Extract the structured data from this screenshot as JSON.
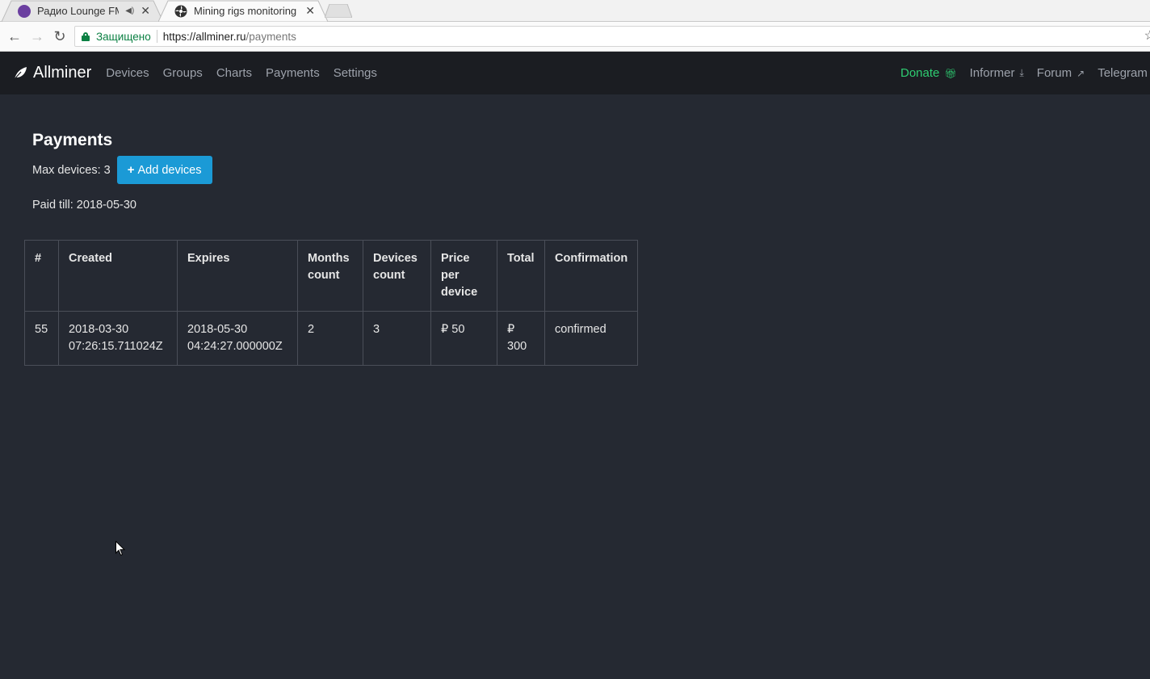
{
  "browser": {
    "tabs": [
      {
        "title": "Радио Lounge FM Ch",
        "active": false,
        "audio": true
      },
      {
        "title": "Mining rigs monitoring -",
        "active": true,
        "audio": false
      }
    ],
    "secure_label": "Защищено",
    "url_host": "https://allminer.ru",
    "url_path": "/payments"
  },
  "navbar": {
    "brand": "Allminer",
    "links": [
      "Devices",
      "Groups",
      "Charts",
      "Payments",
      "Settings"
    ],
    "right": {
      "donate": "Donate",
      "informer": "Informer",
      "forum": "Forum",
      "telegram": "Telegram"
    },
    "colors": {
      "donate": "#2ecc71",
      "accent": "#1b9ad6"
    }
  },
  "page": {
    "title": "Payments",
    "max_devices": "Max devices: 3",
    "add_devices": "Add devices",
    "paid_till": "Paid till: 2018-05-30"
  },
  "table": {
    "headers": [
      "#",
      "Created",
      "Expires",
      "Months count",
      "Devices count",
      "Price per device",
      "Total",
      "Confirmation"
    ],
    "rows": [
      {
        "id": "55",
        "created": "2018-03-30 07:26:15.711024Z",
        "expires": "2018-05-30 04:24:27.000000Z",
        "months": "2",
        "devices": "3",
        "price": "₽ 50",
        "total": "₽ 300",
        "confirmation": "confirmed"
      }
    ]
  }
}
